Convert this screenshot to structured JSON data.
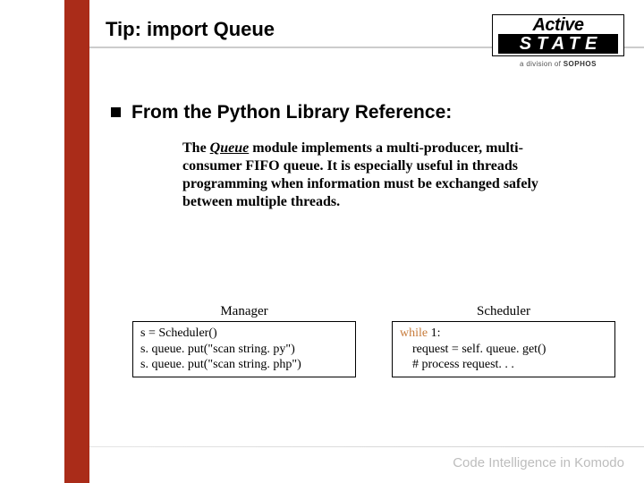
{
  "title": "Tip: import Queue",
  "logo": {
    "line1": "Active",
    "line2": "STATE",
    "sub_prefix": "a division of ",
    "sub_brand": "SOPHOS"
  },
  "bullet": "From the Python Library Reference:",
  "desc_pre": "The ",
  "desc_module": "Queue",
  "desc_post": " module implements a multi-producer, multi-consumer FIFO queue. It is especially useful in threads programming when information must be exchanged safely between multiple threads.",
  "code_left": {
    "title": "Manager",
    "line1": "s = Scheduler()",
    "line2": "s. queue. put(\"scan string. py\")",
    "line3": "s. queue. put(\"scan string. php\")"
  },
  "code_right": {
    "title": "Scheduler",
    "kw": "while",
    "rest1": " 1:",
    "line2": "    request = self. queue. get()",
    "line3": "    # process request. . ."
  },
  "footer": "Code Intelligence in Komodo"
}
